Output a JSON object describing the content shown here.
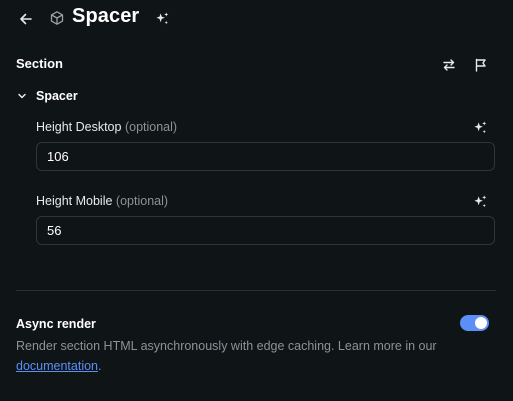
{
  "header": {
    "title": "Spacer",
    "back_icon": "arrow-left-icon",
    "section_icon": "cube-icon",
    "ai_icon": "sparkle-icon"
  },
  "section": {
    "title": "Section",
    "actions": [
      "swap-icon",
      "flag-icon"
    ]
  },
  "group": {
    "label": "Spacer",
    "expanded": true
  },
  "fields": [
    {
      "label": "Height Desktop",
      "hint": "(optional)",
      "value": "106"
    },
    {
      "label": "Height Mobile",
      "hint": "(optional)",
      "value": "56"
    }
  ],
  "async_render": {
    "title": "Async render",
    "enabled": true,
    "description": "Render section HTML asynchronously with edge caching. Learn more in our",
    "link_text": "documentation",
    "suffix": "."
  },
  "colors": {
    "background": "#0f1416",
    "accent": "#5b8ff5",
    "border": "#2f3638",
    "muted_text": "#8b9396"
  }
}
